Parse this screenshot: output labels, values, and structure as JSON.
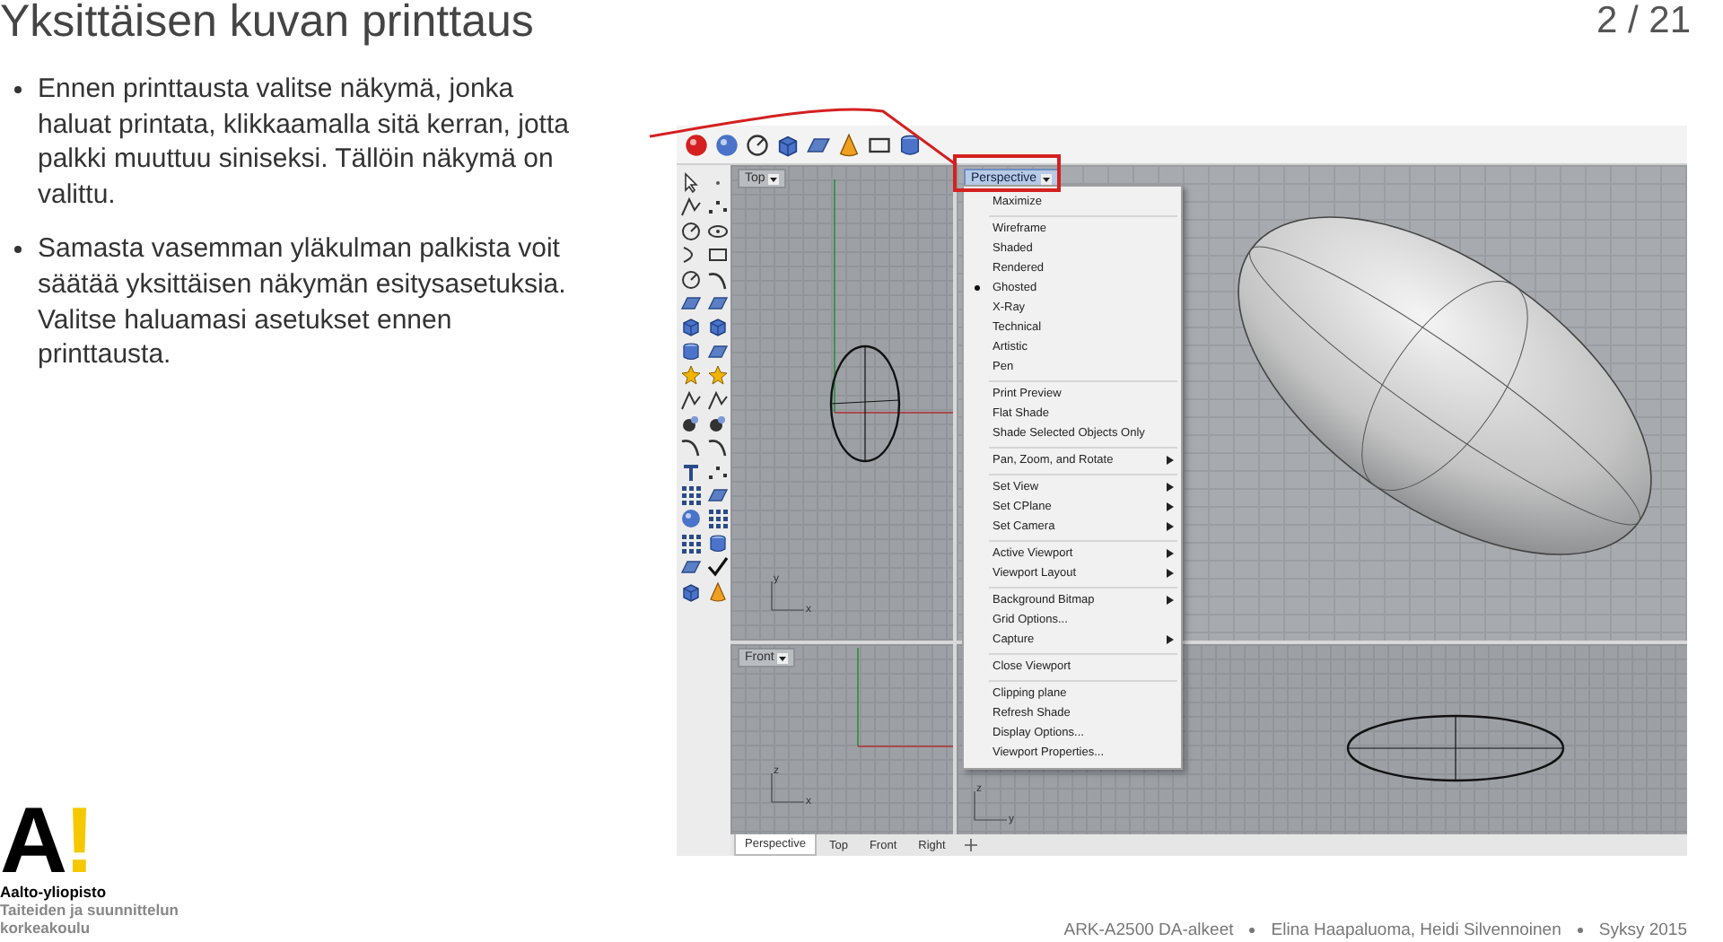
{
  "slide": {
    "title": "Yksittäisen kuvan printtaus",
    "page": "2 / 21"
  },
  "bullets": [
    "Ennen printtausta valitse näkymä, jonka haluat printata, klikkaamalla sitä kerran, jotta palkki muuttuu siniseksi. Tällöin näkymä on valittu.",
    "Samasta vasemman yläkulman palkista voit säätää yksittäisen näkymän esitysasetuksia. Valitse haluamasi asetukset ennen printtausta."
  ],
  "app": {
    "viewports": [
      {
        "kind": "top",
        "label": "Top",
        "selected": false,
        "axes": [
          "y",
          "x"
        ]
      },
      {
        "kind": "perspective",
        "label": "Perspective",
        "selected": true
      },
      {
        "kind": "front",
        "label": "Front",
        "selected": false,
        "axes": [
          "z",
          "x"
        ]
      },
      {
        "kind": "right",
        "axes": [
          "z",
          "y"
        ]
      }
    ],
    "menu": {
      "groups": [
        {
          "items": [
            {
              "label": "Maximize",
              "checked": false,
              "submenu": false
            }
          ]
        },
        {
          "items": [
            {
              "label": "Wireframe",
              "checked": false,
              "submenu": false
            },
            {
              "label": "Shaded",
              "checked": false,
              "submenu": false
            },
            {
              "label": "Rendered",
              "checked": false,
              "submenu": false
            },
            {
              "label": "Ghosted",
              "checked": true,
              "submenu": false
            },
            {
              "label": "X-Ray",
              "checked": false,
              "submenu": false
            },
            {
              "label": "Technical",
              "checked": false,
              "submenu": false
            },
            {
              "label": "Artistic",
              "checked": false,
              "submenu": false
            },
            {
              "label": "Pen",
              "checked": false,
              "submenu": false
            }
          ]
        },
        {
          "items": [
            {
              "label": "Print Preview",
              "checked": false,
              "submenu": false
            },
            {
              "label": "Flat Shade",
              "checked": false,
              "submenu": false
            },
            {
              "label": "Shade Selected Objects Only",
              "checked": false,
              "submenu": false
            }
          ]
        },
        {
          "items": [
            {
              "label": "Pan, Zoom, and Rotate",
              "checked": false,
              "submenu": true
            }
          ]
        },
        {
          "items": [
            {
              "label": "Set View",
              "checked": false,
              "submenu": true
            },
            {
              "label": "Set CPlane",
              "checked": false,
              "submenu": true
            },
            {
              "label": "Set Camera",
              "checked": false,
              "submenu": true
            }
          ]
        },
        {
          "items": [
            {
              "label": "Active Viewport",
              "checked": false,
              "submenu": true
            },
            {
              "label": "Viewport Layout",
              "checked": false,
              "submenu": true
            }
          ]
        },
        {
          "items": [
            {
              "label": "Background Bitmap",
              "checked": false,
              "submenu": true
            },
            {
              "label": "Grid Options...",
              "checked": false,
              "submenu": false
            },
            {
              "label": "Capture",
              "checked": false,
              "submenu": true
            }
          ]
        },
        {
          "items": [
            {
              "label": "Close Viewport",
              "checked": false,
              "submenu": false
            }
          ]
        },
        {
          "items": [
            {
              "label": "Clipping plane",
              "checked": false,
              "submenu": false
            },
            {
              "label": "Refresh Shade",
              "checked": false,
              "submenu": false
            },
            {
              "label": "Display Options...",
              "checked": false,
              "submenu": false
            },
            {
              "label": "Viewport Properties...",
              "checked": false,
              "submenu": false
            }
          ]
        }
      ]
    },
    "tabs": [
      {
        "label": "Perspective",
        "selected": true
      },
      {
        "label": "Top",
        "selected": false
      },
      {
        "label": "Front",
        "selected": false
      },
      {
        "label": "Right",
        "selected": false
      }
    ]
  },
  "logo": {
    "letter": "A",
    "sign": "!",
    "name": "Aalto-yliopisto",
    "school": [
      "Taiteiden ja suunnittelun",
      "korkeakoulu"
    ]
  },
  "footer": [
    "ARK-A2500 DA-alkeet",
    "Elina Haapaluoma, Heidi Silvennoinen",
    "Syksy 2015"
  ]
}
